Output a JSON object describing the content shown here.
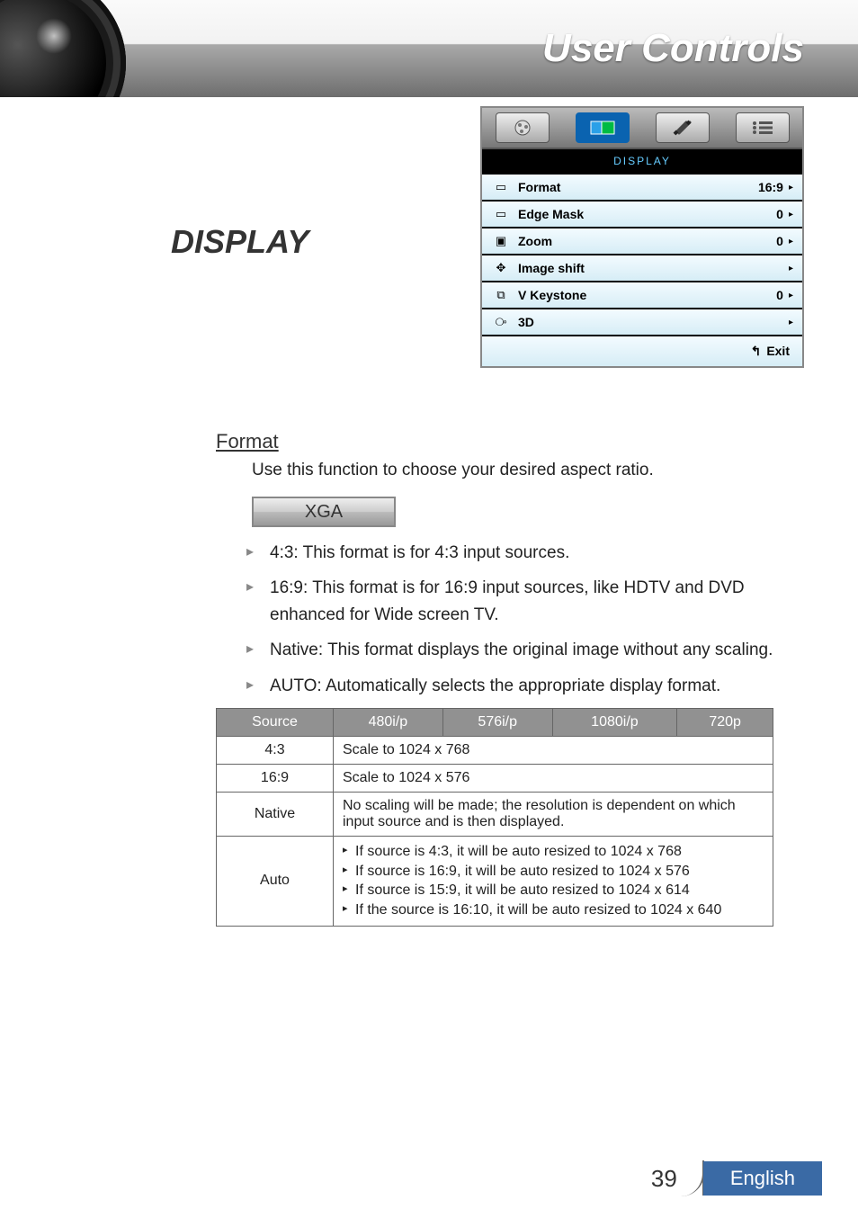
{
  "page_title": "User Controls",
  "section_title": "DISPLAY",
  "osd": {
    "header": "DISPLAY",
    "tabs": {
      "image_icon": "image-icon",
      "display_icon": "display-icon",
      "setup_icon": "setup-icon",
      "options_icon": "options-icon"
    },
    "rows": [
      {
        "icon": "format-icon",
        "label": "Format",
        "value": "16:9"
      },
      {
        "icon": "edge-mask-icon",
        "label": "Edge Mask",
        "value": "0"
      },
      {
        "icon": "zoom-icon",
        "label": "Zoom",
        "value": "0"
      },
      {
        "icon": "image-shift-icon",
        "label": "Image shift",
        "value": ""
      },
      {
        "icon": "v-keystone-icon",
        "label": "V Keystone",
        "value": "0"
      },
      {
        "icon": "three-d-icon",
        "label": "3D",
        "value": ""
      }
    ],
    "exit": "Exit"
  },
  "format": {
    "heading": "Format",
    "desc": "Use this function to choose your desired aspect ratio.",
    "xga": "XGA",
    "bullets": [
      "4:3: This format is for 4:3 input sources.",
      "16:9: This format is for 16:9 input sources, like HDTV and DVD enhanced for Wide screen TV.",
      "Native: This format displays the original image without any scaling.",
      "AUTO: Automatically selects the appropriate display format."
    ]
  },
  "table": {
    "headers": [
      "Source",
      "480i/p",
      "576i/p",
      "1080i/p",
      "720p"
    ],
    "rows": {
      "r1": {
        "head": "4:3",
        "val": "Scale to 1024 x 768"
      },
      "r2": {
        "head": "16:9",
        "val": "Scale to 1024 x 576"
      },
      "r3": {
        "head": "Native",
        "val": "No scaling will be made; the resolution is dependent on which input source and is then displayed."
      },
      "r4": {
        "head": "Auto",
        "lines": [
          "If source is 4:3, it will be auto resized to 1024 x 768",
          "If source is 16:9, it will be auto resized to 1024 x 576",
          "If source is 15:9, it will be auto resized to 1024 x 614",
          "If the source is 16:10, it will be auto resized to 1024 x 640"
        ]
      }
    }
  },
  "footer": {
    "page": "39",
    "lang": "English"
  }
}
